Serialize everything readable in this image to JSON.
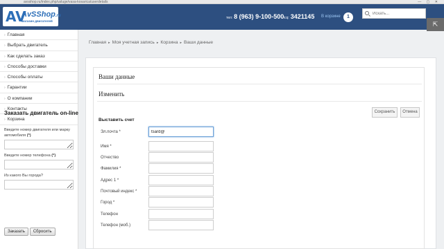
{
  "browser": {
    "url": "avsshop.ru/index.php/usluge/vasa-kosarica/userdetails",
    "url_host": "avsshop.ru",
    "controls": "— ▢ ✕"
  },
  "header": {
    "logo_mark": "AV",
    "logo_name": "AvSShop",
    "logo_domain": ".ru",
    "logo_tagline": "магазин двигателей",
    "phone1_prefix": "тел:",
    "phone1": "8 (963) 9-100-500",
    "phone2_prefix": "icq:",
    "phone2": "3421145",
    "cart_label": "В корзине",
    "cart_count": "1",
    "search_placeholder": "Искать..."
  },
  "sidebar": {
    "menu": [
      {
        "label": "Главная"
      },
      {
        "label": "Выбрать двигатель"
      },
      {
        "label": "Как сделать заказ"
      },
      {
        "label": "Способы доставки"
      },
      {
        "label": "Способы оплаты"
      },
      {
        "label": "Гарантии"
      },
      {
        "label": "О компании"
      },
      {
        "label": "Контакты"
      },
      {
        "label": "Корзина"
      }
    ],
    "order_title": "Заказать двигатель on-line",
    "field1_label": "Введите номер двигателя или марку автомобиля",
    "field1_req": "(*)",
    "field2_label": "Введите номер телефона",
    "field2_req": "(*)",
    "field3_label": "Из какого Вы города?",
    "submit": "Заказать",
    "reset": "Сбросить"
  },
  "breadcrumb": [
    "Главная",
    "Моя учетная запись",
    "Корзина",
    "Ваши данные"
  ],
  "main": {
    "heading": "Ваши данные",
    "subheading": "Изменить",
    "save_label": "Сохранить",
    "cancel_label": "Отмена",
    "section_title": "Выставить счет",
    "fields": [
      {
        "label": "Эл.почта *",
        "value": "tsard@"
      },
      {
        "label": "Имя *",
        "value": ""
      },
      {
        "label": "Отчество",
        "value": ""
      },
      {
        "label": "Фамилия *",
        "value": ""
      },
      {
        "label": "Адрес 1 *",
        "value": ""
      },
      {
        "label": "Почтовый индекс *",
        "value": ""
      },
      {
        "label": "Город *",
        "value": ""
      },
      {
        "label": "Телефон",
        "value": ""
      },
      {
        "label": "Телефон (моб.)",
        "value": ""
      }
    ]
  }
}
